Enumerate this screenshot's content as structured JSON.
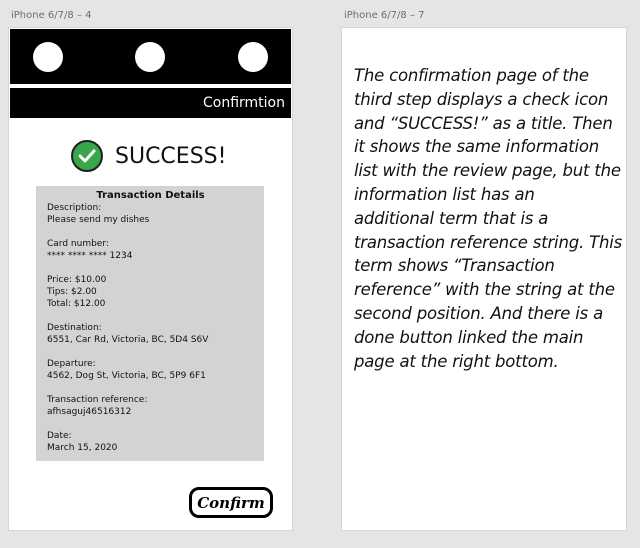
{
  "frames": [
    {
      "label": "iPhone 6/7/8 – 4"
    },
    {
      "label": "iPhone 6/7/8 – 7"
    }
  ],
  "screen": {
    "title": "Confirmtion",
    "success_text": "SUCCESS!",
    "icon": "check-circle-icon",
    "colors": {
      "success": "#3aa54a",
      "bar": "#000000",
      "panel": "#d3d3d3"
    },
    "details": {
      "heading": "Transaction Details",
      "groups": [
        [
          "Description:",
          "Please send my dishes"
        ],
        [
          "Card number:",
          "**** **** **** 1234"
        ],
        [
          "Price: $10.00",
          "Tips: $2.00",
          "Total: $12.00"
        ],
        [
          "Destination:",
          "6551, Car Rd, Victoria, BC, 5D4 S6V"
        ],
        [
          "Departure:",
          "4562, Dog St, Victoria, BC, 5P9 6F1"
        ],
        [
          "Transaction reference:",
          "afhsaguj46516312"
        ],
        [
          "Date:",
          "March 15, 2020"
        ]
      ]
    },
    "confirm_label": "Confirm"
  },
  "note": {
    "lines": [
      "The confirmation page of the",
      "third step displays a check icon",
      "and “SUCCESS!” as a title. Then",
      "it shows the same information",
      "list with the review page, but the",
      "information list has an",
      "additional term that is a",
      "transaction reference string. This",
      "term shows “Transaction",
      "reference” with the string at the",
      "second position. And there is a",
      "done button linked the main",
      "page at the right bottom."
    ]
  }
}
